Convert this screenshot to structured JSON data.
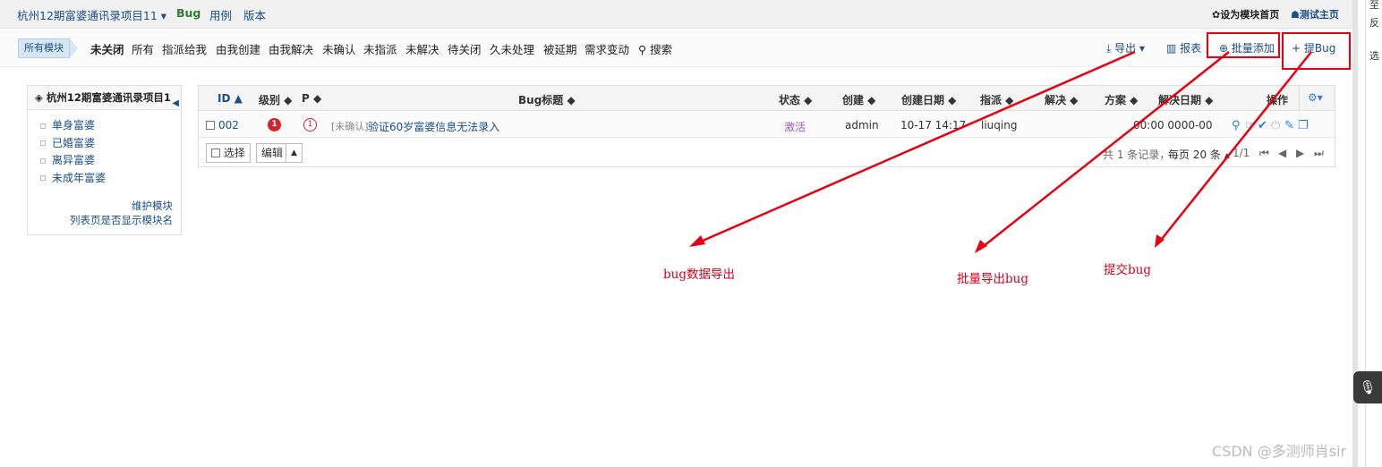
{
  "topbar": {
    "project": "杭州12期富婆通讯录项目11 ▾",
    "nav_bug": "Bug",
    "nav_case": "用例",
    "nav_version": "版本",
    "set_module_home": "✿设为模块首页",
    "test_home": "☗测试主页"
  },
  "subbar": {
    "all_modules": "所有模块",
    "tabs": [
      "未关闭",
      "所有",
      "指派给我",
      "由我创建",
      "由我解决",
      "未确认",
      "未指派",
      "未解决",
      "待关闭",
      "久未处理",
      "被延期",
      "需求变动",
      "搜索"
    ],
    "export": "导出 ▾",
    "report": "报表",
    "batch_add": "批量添加",
    "submit_bug": "提Bug"
  },
  "sidebar": {
    "title": "杭州12期富婆通讯录项目1",
    "items": [
      "单身富婆",
      "已婚富婆",
      "离异富婆",
      "未成年富婆"
    ],
    "maintain": "维护模块",
    "show_module_name": "列表页是否显示模块名"
  },
  "table": {
    "headers": {
      "id": "ID ▲",
      "severity": "级别 ◆",
      "pri": "P ◆",
      "title": "Bug标题 ◆",
      "status": "状态 ◆",
      "creator": "创建 ◆",
      "created_date": "创建日期 ◆",
      "assigned": "指派 ◆",
      "resolved": "解决 ◆",
      "resolution": "方案 ◆",
      "resolved_date": "解决日期 ◆",
      "actions": "操作"
    },
    "rows": [
      {
        "id": "002",
        "severity": "1",
        "pri": "1",
        "tag": "[未确认]",
        "title": "验证60岁富婆信息无法录入",
        "status": "激活",
        "creator": "admin",
        "created_date": "10-17 14:17",
        "assigned": "liuqing",
        "resolved": "",
        "resolution": "",
        "resolved_date": "0000-00 00:00"
      }
    ],
    "footer": {
      "select": "选择",
      "edit": "编辑",
      "records": "共 1 条记录，",
      "per_page": "每页 20 条 ▴",
      "pages": "1/1"
    }
  },
  "annotations": {
    "export_label": "bug数据导出",
    "batch_label": "批量导出bug",
    "submit_label": "提交bug"
  },
  "side_strip": [
    "至",
    "反",
    "选"
  ],
  "watermark": "CSDN @多测师肖sir",
  "colors": {
    "accent": "#1a4f85",
    "annotation": "#d0021b",
    "severity": "#d0262e",
    "status_active": "#9b59b6"
  }
}
